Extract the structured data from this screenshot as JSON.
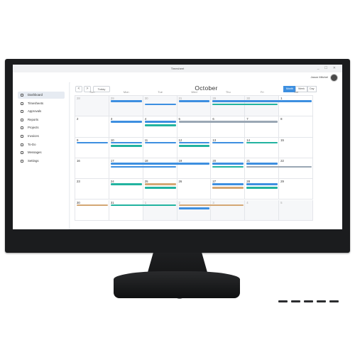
{
  "window": {
    "title": "Timesheet",
    "controls": "_ ☐ ✕"
  },
  "user": {
    "name": "Jason Mitchel"
  },
  "sidebar": {
    "items": [
      {
        "label": "Dashboard",
        "active": true
      },
      {
        "label": "Timesheets"
      },
      {
        "label": "Approvals"
      },
      {
        "label": "Reports"
      },
      {
        "label": "Projects"
      },
      {
        "label": "Invoices"
      },
      {
        "label": "To-Do"
      },
      {
        "label": "Messages"
      },
      {
        "label": "Settings"
      }
    ]
  },
  "toolbar": {
    "prev": "<",
    "next": ">",
    "today": "Today",
    "month": "October",
    "views": [
      "Month",
      "Week",
      "Day"
    ],
    "selected_view": "Month"
  },
  "weekdays": [
    "Sun",
    "Mon",
    "Tue",
    "Wed",
    "Thu",
    "Fri",
    "Sat"
  ],
  "weeks": [
    [
      "28",
      "29",
      "30",
      "31",
      "29",
      "30",
      "1"
    ],
    [
      "2",
      "3",
      "4",
      "5",
      "6",
      "7",
      "8"
    ],
    [
      "9",
      "10",
      "11",
      "12",
      "13",
      "14",
      "15"
    ],
    [
      "16",
      "17",
      "18",
      "19",
      "20",
      "21",
      "22"
    ],
    [
      "23",
      "24",
      "25",
      "26",
      "27",
      "28",
      "29"
    ],
    [
      "30",
      "31",
      "1",
      "2",
      "3",
      "4",
      "5"
    ]
  ],
  "colors": {
    "blue": "#3d8fe0",
    "teal": "#22b3a0",
    "gray": "#9aa7b4",
    "tan": "#d4a774"
  },
  "events": [
    {
      "week": 0,
      "day": 1,
      "span": 1,
      "row": 0,
      "color": "blue"
    },
    {
      "week": 0,
      "day": 2,
      "span": 1,
      "row": 1,
      "color": "blue"
    },
    {
      "week": 0,
      "day": 3,
      "span": 1,
      "row": 0,
      "color": "blue"
    },
    {
      "week": 0,
      "day": 4,
      "span": 3,
      "row": 0,
      "color": "blue"
    },
    {
      "week": 0,
      "day": 4,
      "span": 2,
      "row": 1,
      "color": "teal"
    },
    {
      "week": 1,
      "day": 1,
      "span": 1,
      "row": 0,
      "color": "blue"
    },
    {
      "week": 1,
      "day": 2,
      "span": 1,
      "row": 0,
      "color": "blue"
    },
    {
      "week": 1,
      "day": 2,
      "span": 1,
      "row": 1,
      "color": "teal"
    },
    {
      "week": 1,
      "day": 3,
      "span": 3,
      "row": 0,
      "color": "gray"
    },
    {
      "week": 2,
      "day": 0,
      "span": 1,
      "row": 0,
      "color": "blue"
    },
    {
      "week": 2,
      "day": 1,
      "span": 1,
      "row": 0,
      "color": "blue"
    },
    {
      "week": 2,
      "day": 1,
      "span": 1,
      "row": 1,
      "color": "teal"
    },
    {
      "week": 2,
      "day": 2,
      "span": 1,
      "row": 0,
      "color": "blue"
    },
    {
      "week": 2,
      "day": 3,
      "span": 1,
      "row": 0,
      "color": "blue"
    },
    {
      "week": 2,
      "day": 3,
      "span": 1,
      "row": 1,
      "color": "teal"
    },
    {
      "week": 2,
      "day": 4,
      "span": 1,
      "row": 0,
      "color": "blue"
    },
    {
      "week": 2,
      "day": 5,
      "span": 1,
      "row": 0,
      "color": "teal"
    },
    {
      "week": 3,
      "day": 1,
      "span": 3,
      "row": 0,
      "color": "blue"
    },
    {
      "week": 3,
      "day": 1,
      "span": 2,
      "row": 1,
      "color": "blue"
    },
    {
      "week": 3,
      "day": 4,
      "span": 1,
      "row": 0,
      "color": "blue"
    },
    {
      "week": 3,
      "day": 4,
      "span": 1,
      "row": 1,
      "color": "teal"
    },
    {
      "week": 3,
      "day": 5,
      "span": 1,
      "row": 0,
      "color": "blue"
    },
    {
      "week": 3,
      "day": 5,
      "span": 2,
      "row": 1,
      "color": "gray"
    },
    {
      "week": 4,
      "day": 1,
      "span": 1,
      "row": 0,
      "color": "teal"
    },
    {
      "week": 4,
      "day": 2,
      "span": 1,
      "row": 0,
      "color": "tan"
    },
    {
      "week": 4,
      "day": 2,
      "span": 1,
      "row": 1,
      "color": "teal"
    },
    {
      "week": 4,
      "day": 4,
      "span": 1,
      "row": 0,
      "color": "blue"
    },
    {
      "week": 4,
      "day": 4,
      "span": 1,
      "row": 1,
      "color": "tan"
    },
    {
      "week": 4,
      "day": 5,
      "span": 1,
      "row": 0,
      "color": "blue"
    },
    {
      "week": 4,
      "day": 5,
      "span": 1,
      "row": 1,
      "color": "teal"
    },
    {
      "week": 5,
      "day": 0,
      "span": 1,
      "row": 0,
      "color": "tan"
    },
    {
      "week": 5,
      "day": 1,
      "span": 2,
      "row": 0,
      "color": "teal"
    },
    {
      "week": 5,
      "day": 3,
      "span": 2,
      "row": 0,
      "color": "tan"
    },
    {
      "week": 5,
      "day": 3,
      "span": 1,
      "row": 1,
      "color": "blue"
    }
  ]
}
